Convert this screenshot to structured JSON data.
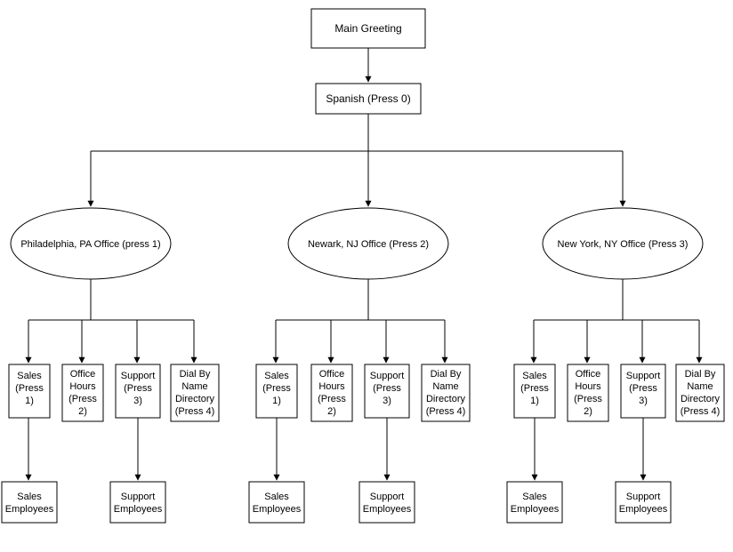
{
  "root": {
    "label": "Main Greeting"
  },
  "lang": {
    "label": "Spanish (Press 0)"
  },
  "offices": [
    {
      "label": "Philadelphia, PA Office (press 1)"
    },
    {
      "label": "Newark, NJ Office (Press 2)"
    },
    {
      "label": "New York, NY Office (Press 3)"
    }
  ],
  "options": {
    "sales": {
      "l1": "Sales",
      "l2": "(Press",
      "l3": "1)"
    },
    "hours": {
      "l1": "Office",
      "l2": "Hours",
      "l3": "(Press",
      "l4": "2)"
    },
    "support": {
      "l1": "Support",
      "l2": "(Press",
      "l3": "3)"
    },
    "dial": {
      "l1": "Dial By",
      "l2": "Name",
      "l3": "Directory",
      "l4": "(Press 4)"
    }
  },
  "leaves": {
    "sales": {
      "l1": "Sales",
      "l2": "Employees"
    },
    "support": {
      "l1": "Support",
      "l2": "Employees"
    }
  }
}
